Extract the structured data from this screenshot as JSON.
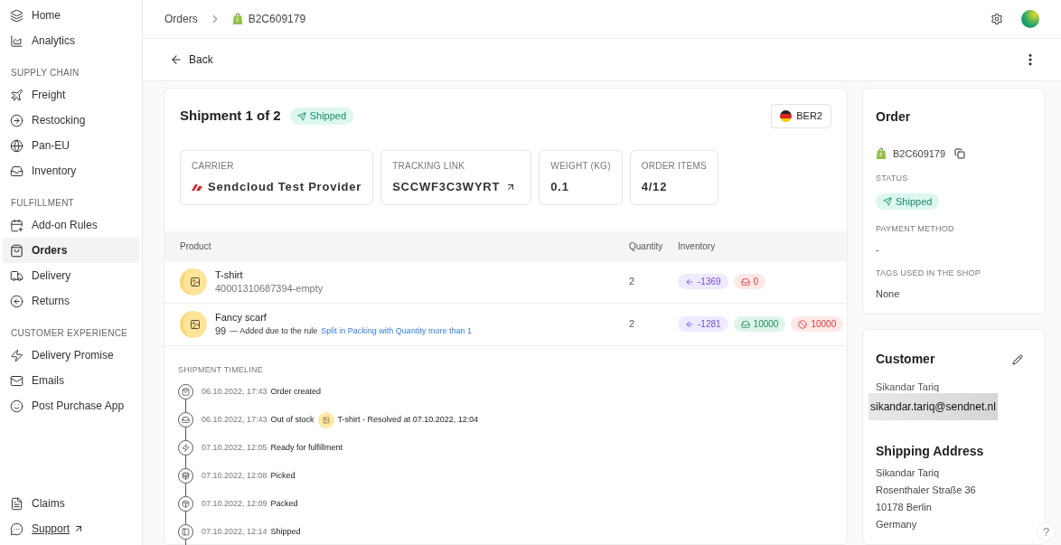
{
  "sidebar": {
    "sections": [
      {
        "items": [
          {
            "label": "Home",
            "selected": false
          },
          {
            "label": "Analytics",
            "selected": false
          }
        ]
      },
      {
        "heading": "SUPPLY CHAIN",
        "items": [
          {
            "label": "Freight",
            "selected": false
          },
          {
            "label": "Restocking",
            "selected": false
          },
          {
            "label": "Pan-EU",
            "selected": false
          },
          {
            "label": "Inventory",
            "selected": false
          }
        ]
      },
      {
        "heading": "FULFILLMENT",
        "items": [
          {
            "label": "Add-on Rules",
            "selected": false
          },
          {
            "label": "Orders",
            "selected": true
          },
          {
            "label": "Delivery",
            "selected": false
          },
          {
            "label": "Returns",
            "selected": false
          }
        ]
      },
      {
        "heading": "CUSTOMER EXPERIENCE",
        "items": [
          {
            "label": "Delivery Promise",
            "selected": false
          },
          {
            "label": "Emails",
            "selected": false
          },
          {
            "label": "Post Purchase App",
            "selected": false
          }
        ]
      }
    ],
    "bottom": [
      {
        "label": "Claims",
        "link": false
      },
      {
        "label": "Support",
        "link": true
      }
    ]
  },
  "breadcrumb": [
    "Orders",
    "B2C609179"
  ],
  "back": "Back",
  "shipment": {
    "title": "Shipment 1 of 2",
    "status": "Shipped",
    "warehouse": "BER2",
    "stats": [
      {
        "label": "CARRIER",
        "value": "Sendcloud Test Provider",
        "kind": "carrier"
      },
      {
        "label": "TRACKING LINK",
        "value": "SCCWF3C3WYRT",
        "kind": "link"
      },
      {
        "label": "WEIGHT (KG)",
        "value": "0.1",
        "kind": "plain"
      },
      {
        "label": "ORDER ITEMS",
        "value": "4/12",
        "kind": "plain"
      }
    ],
    "columns": [
      "Product",
      "Quantity",
      "Inventory"
    ],
    "rows": [
      {
        "name": "T-shirt",
        "sku": "40001310687394-empty",
        "quantity": "2",
        "badges": [
          {
            "kind": "incoming",
            "text": "-1369"
          },
          {
            "kind": "stock-out",
            "text": "0"
          }
        ]
      },
      {
        "name": "Fancy scarf",
        "sku": "99",
        "note": "— Added due to the rule",
        "rule": "Split in Packing with Quantity more than 1",
        "quantity": "2",
        "badges": [
          {
            "kind": "incoming",
            "text": "-1281"
          },
          {
            "kind": "stock",
            "text": "10000"
          },
          {
            "kind": "blocked",
            "text": "10000"
          }
        ]
      }
    ],
    "timeline_title": "SHIPMENT TIMELINE",
    "timeline": [
      {
        "time": "06.10.2022, 17:43",
        "event": "Order created"
      },
      {
        "time": "06.10.2022, 17:43",
        "event": "Out of stock",
        "detail": "T-shirt - Resolved at 07.10.2022, 12:04"
      },
      {
        "time": "07.10.2022, 12:05",
        "event": "Ready for fulfillment"
      },
      {
        "time": "07.10.2022, 12:08",
        "event": "Picked"
      },
      {
        "time": "07.10.2022, 12:09",
        "event": "Packed"
      },
      {
        "time": "07.10.2022, 12:14",
        "event": "Shipped"
      }
    ]
  },
  "order": {
    "title": "Order",
    "number": "B2C609179",
    "fields": [
      {
        "label": "STATUS",
        "value": "Shipped",
        "kind": "status"
      },
      {
        "label": "PAYMENT METHOD",
        "value": "-",
        "kind": "text"
      },
      {
        "label": "TAGS USED IN THE SHOP",
        "value": "None",
        "kind": "text"
      }
    ]
  },
  "customer": {
    "title": "Customer",
    "name": "Sikandar Tariq",
    "tooltip": "sikandar.tariq@sendnet.nl"
  },
  "shipping": {
    "title": "Shipping Address",
    "lines": [
      "Sikandar Tariq",
      "Rosenthaler Straße 36",
      "10178 Berlin",
      "Germany"
    ]
  },
  "help": "?"
}
